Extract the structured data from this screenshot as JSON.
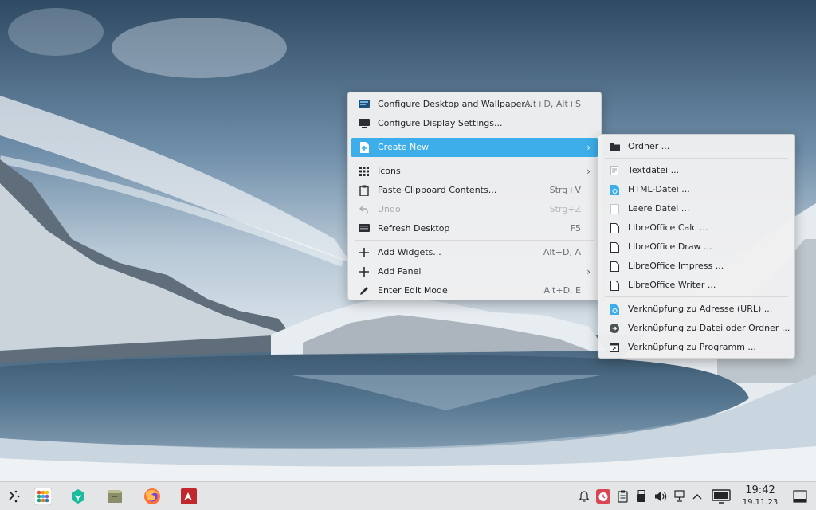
{
  "main_menu": {
    "items": [
      {
        "label": "Configure Desktop and Wallpaper...",
        "shortcut": "Alt+D, Alt+S",
        "icon": "desktop-settings-icon"
      },
      {
        "label": "Configure Display Settings...",
        "shortcut": "",
        "icon": "display-icon"
      },
      {
        "label": "Create New",
        "shortcut": "",
        "icon": "new-file-icon",
        "highlighted": true,
        "submenu": true
      },
      {
        "label": "Icons",
        "shortcut": "",
        "icon": "grid-icon",
        "submenu": true
      },
      {
        "label": "Paste Clipboard Contents...",
        "shortcut": "Strg+V",
        "icon": "clipboard-icon"
      },
      {
        "label": "Undo",
        "shortcut": "Strg+Z",
        "icon": "undo-icon",
        "disabled": true
      },
      {
        "label": "Refresh Desktop",
        "shortcut": "F5",
        "icon": "refresh-icon"
      },
      {
        "label": "Add Widgets...",
        "shortcut": "Alt+D, A",
        "icon": "plus-icon"
      },
      {
        "label": "Add Panel",
        "shortcut": "",
        "icon": "plus-icon",
        "submenu": true
      },
      {
        "label": "Enter Edit Mode",
        "shortcut": "Alt+D, E",
        "icon": "pencil-icon"
      }
    ]
  },
  "sub_menu": {
    "items": [
      {
        "label": "Ordner ...",
        "icon": "folder-icon"
      },
      {
        "label": "Textdatei ...",
        "icon": "text-file-icon"
      },
      {
        "label": "HTML-Datei ...",
        "icon": "html-file-icon"
      },
      {
        "label": "Leere Datei ...",
        "icon": "empty-file-icon"
      },
      {
        "label": "LibreOffice Calc  ...",
        "icon": "document-icon"
      },
      {
        "label": "LibreOffice Draw  ...",
        "icon": "document-icon"
      },
      {
        "label": "LibreOffice Impress  ...",
        "icon": "document-icon"
      },
      {
        "label": "LibreOffice Writer  ...",
        "icon": "document-icon"
      },
      {
        "label": "Verknüpfung zu Adresse (URL) ...",
        "icon": "url-link-icon"
      },
      {
        "label": "Verknüpfung zu Datei oder Ordner ...",
        "icon": "link-icon"
      },
      {
        "label": "Verknüpfung zu Programm ...",
        "icon": "program-link-icon"
      }
    ]
  },
  "taskbar": {
    "clock_time": "19:42",
    "clock_date": "19.11.23",
    "apps": [
      "application-launcher-icon",
      "app-grid-icon",
      "software-center-icon",
      "file-manager-icon",
      "firefox-icon",
      "remote-app-icon"
    ],
    "tray": [
      "notifications-bell-icon",
      "alarm-clock-icon",
      "clipboard-icon",
      "usb-device-icon",
      "volume-icon",
      "network-icon",
      "expand-tray-icon",
      "display-config-icon",
      "show-desktop-icon"
    ]
  },
  "colors": {
    "highlight": "#3daee9",
    "menu_bg": "#eff0f1",
    "taskbar_bg": "#e3e5e7"
  }
}
